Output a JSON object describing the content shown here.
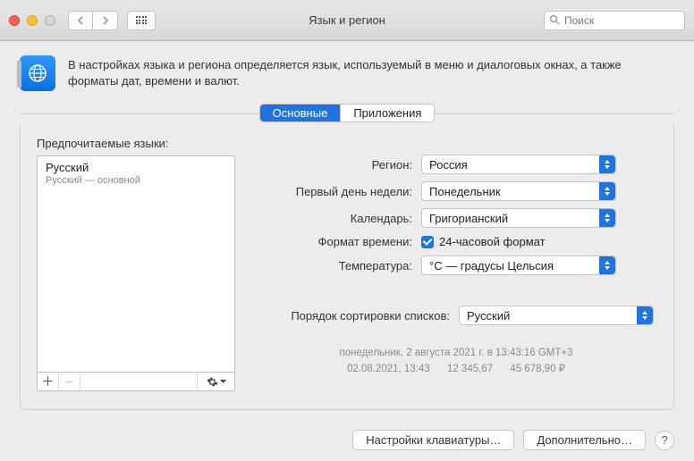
{
  "window": {
    "title": "Язык и регион"
  },
  "search": {
    "placeholder": "Поиск"
  },
  "description": "В настройках языка и региона определяется язык, используемый в меню и диалоговых окнах, а также форматы дат, времени и валют.",
  "tabs": {
    "general": "Основные",
    "apps": "Приложения"
  },
  "preferred_label": "Предпочитаемые языки:",
  "languages": [
    {
      "name": "Русский",
      "subtitle": "Русский — основной"
    }
  ],
  "fields": {
    "region": {
      "label": "Регион:",
      "value": "Россия"
    },
    "first_day": {
      "label": "Первый день недели:",
      "value": "Понедельник"
    },
    "calendar": {
      "label": "Календарь:",
      "value": "Григорианский"
    },
    "time_format": {
      "label": "Формат времени:",
      "checkbox_label": "24-часовой формат"
    },
    "temperature": {
      "label": "Температура:",
      "value": "°C — градусы Цельсия"
    },
    "sort_order": {
      "label": "Порядок сортировки списков:",
      "value": "Русский"
    }
  },
  "examples": {
    "line1": "понедельник, 2 августа 2021 г. в 13:43:16 GMT+3",
    "date_short": "02.08.2021, 13:43",
    "number": "12 345,67",
    "currency": "45 678,90 ₽"
  },
  "footer": {
    "keyboard": "Настройки клавиатуры…",
    "advanced": "Дополнительно…"
  }
}
